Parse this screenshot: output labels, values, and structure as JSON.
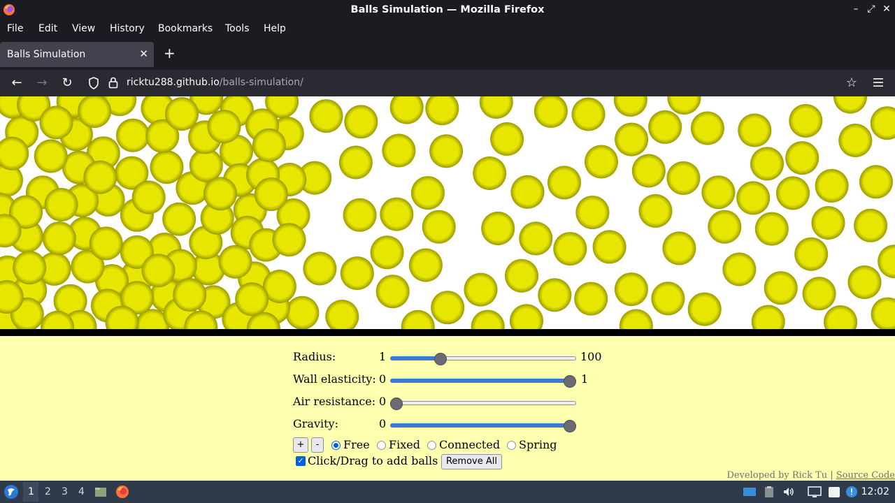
{
  "window": {
    "title": "Balls Simulation — Mozilla Firefox",
    "controls": {
      "minimize": "–",
      "maximize": "⤢",
      "close": "✕"
    }
  },
  "menu": [
    "File",
    "Edit",
    "View",
    "History",
    "Bookmarks",
    "Tools",
    "Help"
  ],
  "tab": {
    "label": "Balls Simulation",
    "close": "✕",
    "new": "+"
  },
  "nav": {
    "back": "←",
    "forward": "→",
    "reload": "↻",
    "url_host": "ricktu288.github.io",
    "url_path": "/balls-simulation/",
    "bookmark": "☆"
  },
  "simulation": {
    "ball_color": "#e6e600",
    "ball_edge_color": "#9a9a00",
    "ball_radius_value": 26
  },
  "controls": {
    "radius": {
      "label": "Radius:",
      "min": "1",
      "max": "100",
      "value": 26
    },
    "wall_elasticity": {
      "label": "Wall elasticity:",
      "min": "0",
      "max": "1",
      "value": 1
    },
    "air_resistance": {
      "label": "Air resistance:",
      "min": "0",
      "value": 0
    },
    "gravity": {
      "label": "Gravity:",
      "min": "0",
      "value": 1
    },
    "add_button": "+",
    "remove_button": "-",
    "modes": [
      {
        "label": "Free",
        "checked": true
      },
      {
        "label": "Fixed",
        "checked": false
      },
      {
        "label": "Connected",
        "checked": false
      },
      {
        "label": "Spring",
        "checked": false
      }
    ],
    "click_drag": {
      "label": "Click/Drag to add balls",
      "checked": true
    },
    "remove_all": "Remove All"
  },
  "footer": {
    "credit": "Developed by Rick Tu",
    "separator": " | ",
    "source": "Source Code"
  },
  "taskbar": {
    "workspaces": [
      "1",
      "2",
      "3",
      "4"
    ],
    "active_workspace": "1",
    "clock": "12:02"
  }
}
